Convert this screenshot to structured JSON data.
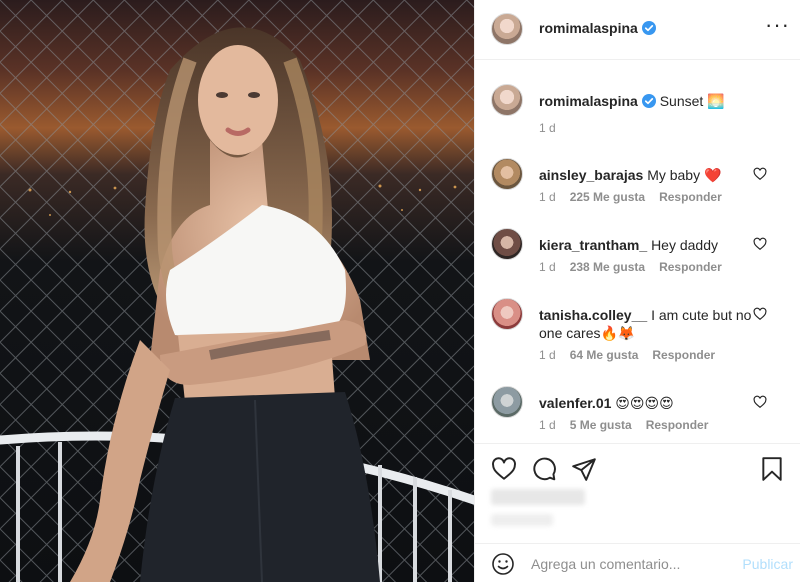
{
  "post": {
    "username": "romimalaspina",
    "more_icon": "ellipsis-icon",
    "caption": "Sunset 🌅",
    "caption_age": "1 d"
  },
  "comments": [
    {
      "username": "ainsley_barajas",
      "text": "My baby ❤️",
      "age": "1 d",
      "likes": "225 Me gusta",
      "reply": "Responder"
    },
    {
      "username": "kiera_trantham_",
      "text": "Hey daddy",
      "age": "1 d",
      "likes": "238 Me gusta",
      "reply": "Responder"
    },
    {
      "username": "tanisha.colley__",
      "text": "I am cute but no one cares🔥🦊",
      "age": "1 d",
      "likes": "64 Me gusta",
      "reply": "Responder"
    },
    {
      "username": "valenfer.01",
      "text": "😍😍😍😍",
      "age": "1 d",
      "likes": "5 Me gusta",
      "reply": "Responder"
    }
  ],
  "add_comment": {
    "placeholder": "Agrega un comentario...",
    "publish": "Publicar"
  },
  "colors": {
    "verified": "#3897f0",
    "link": "#b2dffc",
    "secondary_text": "#8e8e8e"
  }
}
